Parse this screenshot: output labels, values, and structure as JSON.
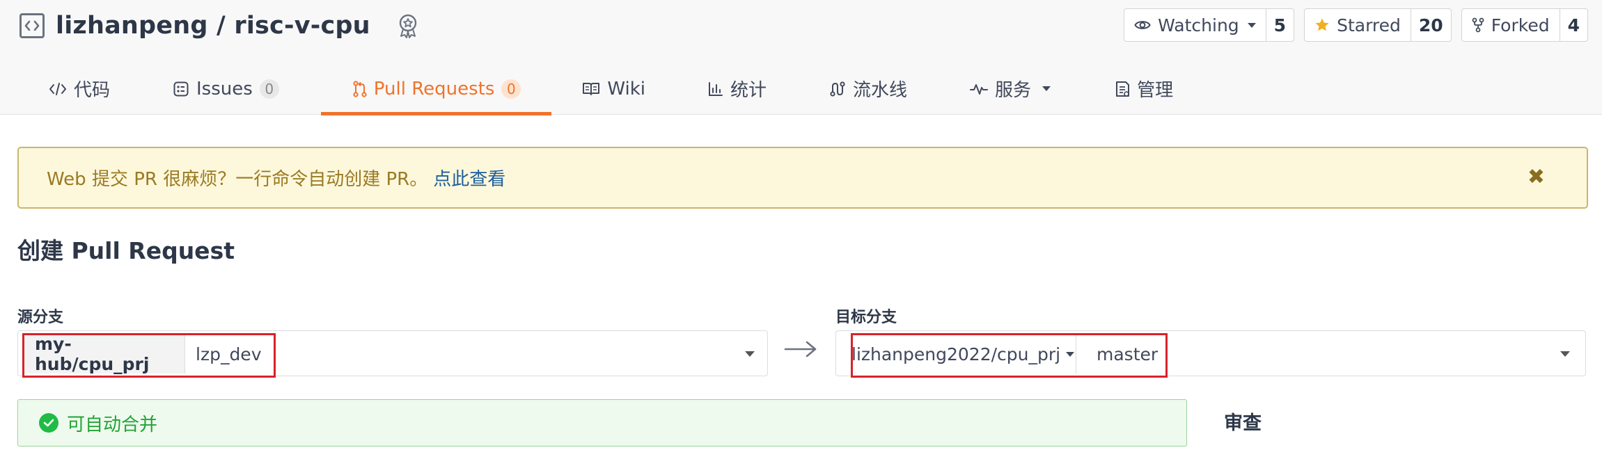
{
  "repo": {
    "owner": "lizhanpeng",
    "separator": "/",
    "name": "risc-v-cpu"
  },
  "actions": {
    "watch": {
      "label": "Watching",
      "count": "5"
    },
    "star": {
      "label": "Starred",
      "count": "20"
    },
    "fork": {
      "label": "Forked",
      "count": "4"
    }
  },
  "tabs": [
    {
      "label": "代码",
      "icon": "code-icon"
    },
    {
      "label": "Issues",
      "count": "0",
      "icon": "issues-icon"
    },
    {
      "label": "Pull Requests",
      "count": "0",
      "icon": "pull-request-icon",
      "active": true
    },
    {
      "label": "Wiki",
      "icon": "wiki-icon"
    },
    {
      "label": "统计",
      "icon": "stats-icon"
    },
    {
      "label": "流水线",
      "icon": "pipeline-icon"
    },
    {
      "label": "服务",
      "icon": "service-icon"
    },
    {
      "label": "管理",
      "icon": "manage-icon"
    }
  ],
  "notice": {
    "text": "Web 提交 PR 很麻烦？一行命令自动创建 PR。",
    "link": "点此查看"
  },
  "page_title": "创建 Pull Request",
  "source": {
    "label": "源分支",
    "repo": "my-hub/cpu_prj",
    "branch": "lzp_dev"
  },
  "target": {
    "label": "目标分支",
    "repo": "lizhanpeng2022/cpu_prj",
    "branch": "master"
  },
  "merge_status": "可自动合并",
  "review_label": "审查",
  "colors": {
    "accent": "#f0732b",
    "highlight": "#d7222a",
    "success": "#21ba45",
    "notice_bg": "#fdf8dc"
  }
}
